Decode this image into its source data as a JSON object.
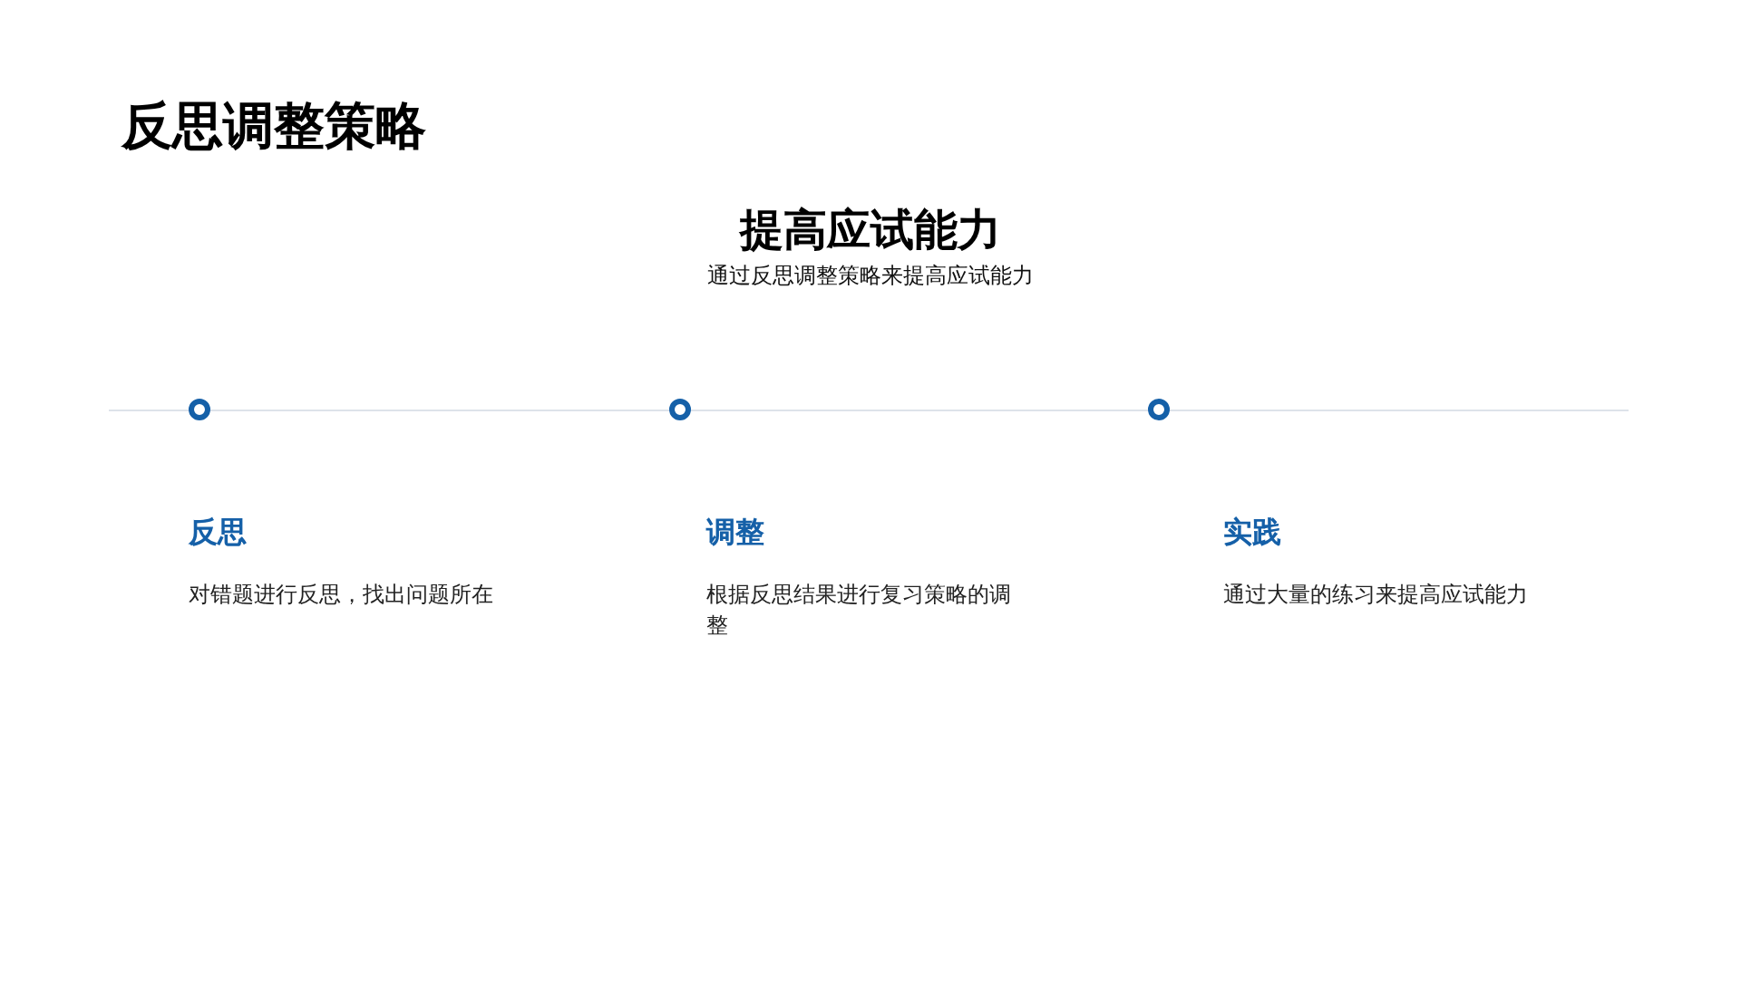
{
  "slide": {
    "title": "反思调整策略",
    "heading": "提高应试能力",
    "subtitle": "通过反思调整策略来提高应试能力"
  },
  "steps": [
    {
      "title": "反思",
      "description": "对错题进行反思，找出问题所在"
    },
    {
      "title": "调整",
      "description": "根据反思结果进行复习策略的调整"
    },
    {
      "title": "实践",
      "description": "通过大量的练习来提高应试能力"
    }
  ]
}
